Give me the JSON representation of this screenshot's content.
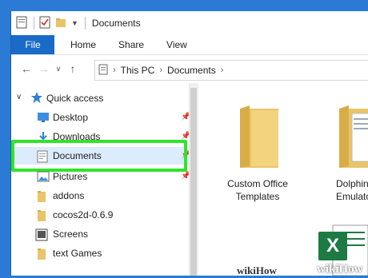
{
  "window": {
    "title": "Documents"
  },
  "ribbon": {
    "tabs": [
      "File",
      "Home",
      "Share",
      "View"
    ]
  },
  "address": {
    "crumbs": [
      "This PC",
      "Documents"
    ]
  },
  "nav": {
    "quick_access": "Quick access",
    "items": [
      {
        "label": "Desktop",
        "icon": "desktop-icon"
      },
      {
        "label": "Downloads",
        "icon": "download-icon"
      },
      {
        "label": "Documents",
        "icon": "document-icon"
      },
      {
        "label": "Pictures",
        "icon": "picture-icon"
      },
      {
        "label": "addons",
        "icon": "folder-icon"
      },
      {
        "label": "cocos2d-0.6.9",
        "icon": "folder-icon"
      },
      {
        "label": "Screens",
        "icon": "monitor-icon"
      },
      {
        "label": "text Games",
        "icon": "folder-icon"
      }
    ]
  },
  "main": {
    "tiles": [
      {
        "label": "Custom Office Templates"
      },
      {
        "label": "Dolphin Emulator"
      }
    ],
    "excel_icon_letter": "X"
  },
  "watermark": {
    "text1": "wikiHow",
    "text2": "wikiHow"
  },
  "colors": {
    "desktop": "#2b7bd6",
    "file_tab": "#1a6ac7",
    "highlight": "#2ee52b",
    "selected": "#dcecfc",
    "folder": "#e8c46a"
  }
}
